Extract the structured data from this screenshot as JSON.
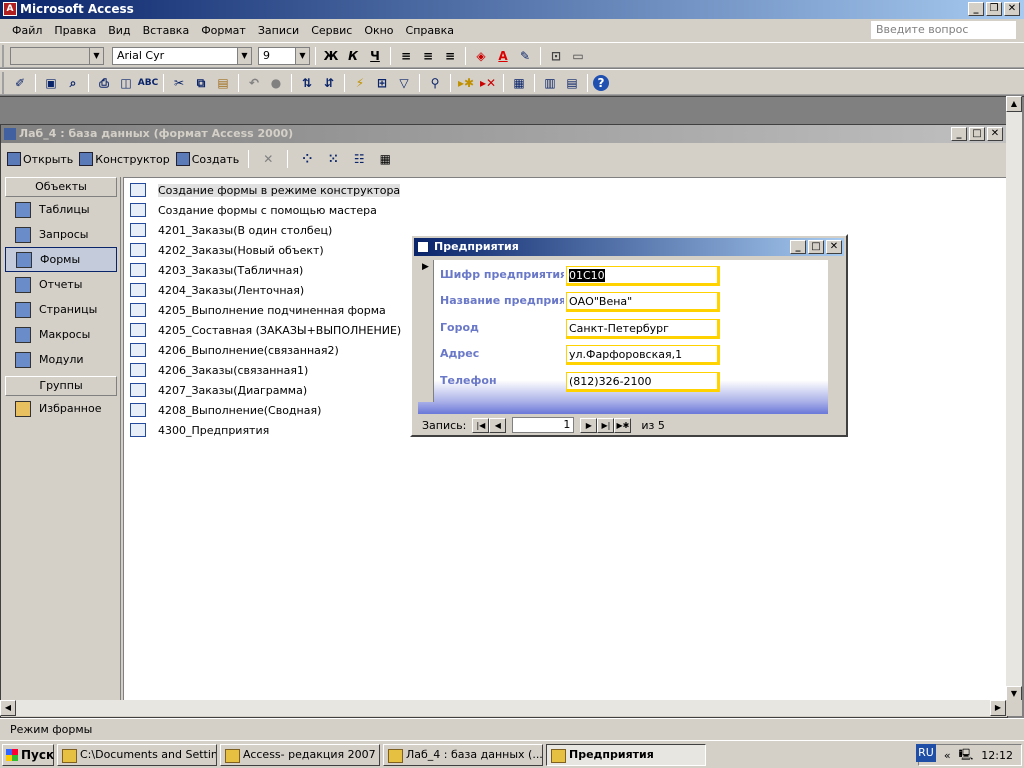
{
  "app": {
    "title": "Microsoft Access",
    "icon": "access-icon"
  },
  "menu": [
    "Файл",
    "Правка",
    "Вид",
    "Вставка",
    "Формат",
    "Записи",
    "Сервис",
    "Окно",
    "Справка"
  ],
  "ask_placeholder": "Введите вопрос",
  "format_toolbar": {
    "object_combo": "",
    "font": "Arial Cyr",
    "size": "9"
  },
  "db_window": {
    "title": "Лаб_4 : база данных (формат Access 2000)",
    "toolbar": {
      "open": "Открыть",
      "design": "Конструктор",
      "create": "Создать"
    },
    "objects_header": "Объекты",
    "groups_header": "Группы",
    "objects": [
      {
        "label": "Таблицы",
        "icon": "tables-icon"
      },
      {
        "label": "Запросы",
        "icon": "queries-icon"
      },
      {
        "label": "Формы",
        "icon": "forms-icon"
      },
      {
        "label": "Отчеты",
        "icon": "reports-icon"
      },
      {
        "label": "Страницы",
        "icon": "pages-icon"
      },
      {
        "label": "Макросы",
        "icon": "macros-icon"
      },
      {
        "label": "Модули",
        "icon": "modules-icon"
      }
    ],
    "groups": [
      {
        "label": "Избранное",
        "icon": "favorites-icon"
      }
    ],
    "forms": [
      "Создание формы в режиме конструктора",
      "Создание формы с помощью мастера",
      "4201_Заказы(В один столбец)",
      "4202_Заказы(Новый объект)",
      "4203_Заказы(Табличная)",
      "4204_Заказы(Ленточная)",
      "4205_Выполнение подчиненная форма",
      "4205_Составная (ЗАКАЗЫ+ВЫПОЛНЕНИЕ)",
      "4206_Выполнение(связанная2)",
      "4206_Заказы(связанная1)",
      "4207_Заказы(Диаграмма)",
      "4208_Выполнение(Сводная)",
      "4300_Предприятия"
    ]
  },
  "form_window": {
    "title": "Предприятия",
    "fields": [
      {
        "label": "Шифр предприятия",
        "value": "01С10"
      },
      {
        "label": "Название предприятия",
        "value": "ОАО\"Вена\""
      },
      {
        "label": "Город",
        "value": "Санкт-Петербург"
      },
      {
        "label": "Адрес",
        "value": "ул.Фарфоровская,1"
      },
      {
        "label": "Телефон",
        "value": "(812)326-2100"
      }
    ],
    "nav": {
      "label": "Запись:",
      "current": "1",
      "of_text": "из 5"
    }
  },
  "status_text": "Режим формы",
  "taskbar": {
    "start": "Пуск",
    "tasks": [
      "C:\\Documents and Settin...",
      "Access- редакция 2007 ...",
      "Лаб_4 : база данных (...",
      "Предприятия"
    ],
    "lang": "RU",
    "time": "12:12"
  }
}
